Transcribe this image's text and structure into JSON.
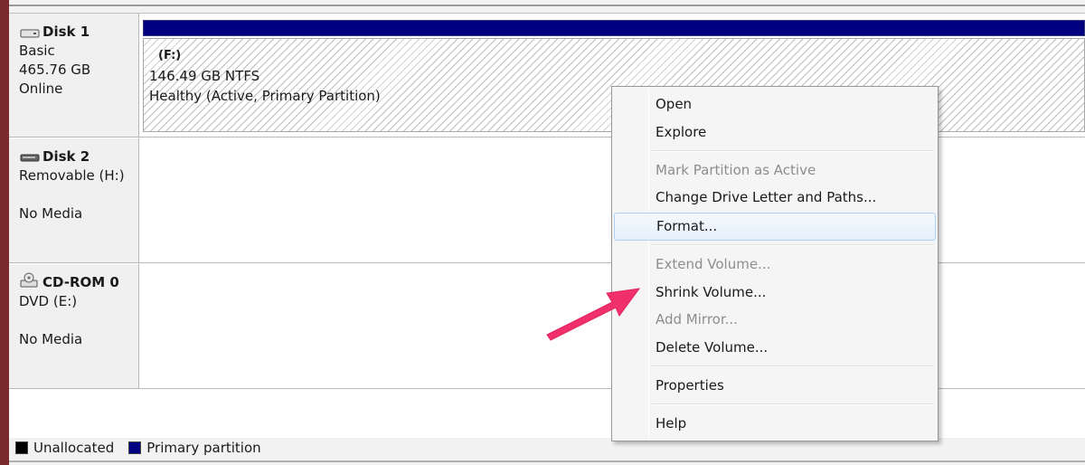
{
  "disks": [
    {
      "name": "Disk 1",
      "type": "Basic",
      "size": "465.76 GB",
      "status": "Online",
      "icon": "hard-disk-icon",
      "partition": {
        "letter": "(F:)",
        "size_fs": "146.49 GB NTFS",
        "health": "Healthy (Active, Primary Partition)"
      }
    },
    {
      "name": "Disk 2",
      "type": "Removable (H:)",
      "status": "No Media",
      "icon": "removable-disk-icon"
    },
    {
      "name": "CD-ROM 0",
      "type": "DVD (E:)",
      "status": "No Media",
      "icon": "cdrom-icon"
    }
  ],
  "context_menu": {
    "open": "Open",
    "explore": "Explore",
    "mark_active": "Mark Partition as Active",
    "change_letter": "Change Drive Letter and Paths...",
    "format": "Format...",
    "extend": "Extend Volume...",
    "shrink": "Shrink Volume...",
    "add_mirror": "Add Mirror...",
    "delete": "Delete Volume...",
    "properties": "Properties",
    "help": "Help"
  },
  "legend": {
    "unallocated": "Unallocated",
    "primary": "Primary partition"
  },
  "colors": {
    "primary_partition": "#000080",
    "unallocated": "#000000",
    "arrow": "#f0306a"
  }
}
